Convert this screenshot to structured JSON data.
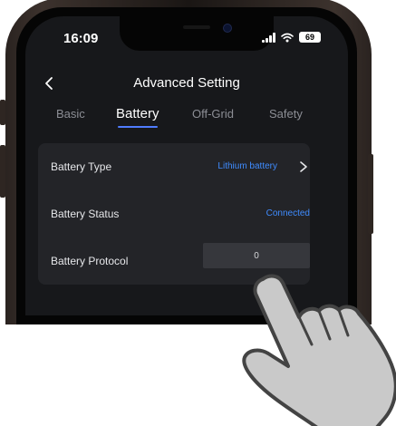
{
  "status_bar": {
    "time": "16:09",
    "battery": "69"
  },
  "header": {
    "title": "Advanced Setting"
  },
  "tabs": [
    {
      "label": "Basic"
    },
    {
      "label": "Battery"
    },
    {
      "label": "Off-Grid"
    },
    {
      "label": "Safety"
    }
  ],
  "rows": {
    "battery_type": {
      "label": "Battery Type",
      "value": "Lithium battery"
    },
    "battery_status": {
      "label": "Battery Status",
      "value": "Connected"
    },
    "battery_protocol": {
      "label": "Battery Protocol",
      "value": "0"
    }
  },
  "colors": {
    "accent": "#3f8cff",
    "tab_underline": "#4f7cff",
    "screen_bg": "#17181b",
    "card_bg": "#232428",
    "hand_fill": "#c9c9c9"
  },
  "icons": [
    "back-arrow-icon",
    "chevron-right-icon",
    "wifi-icon",
    "signal-icon",
    "battery-icon",
    "pointing-hand-icon"
  ],
  "selected_tab": "Battery"
}
